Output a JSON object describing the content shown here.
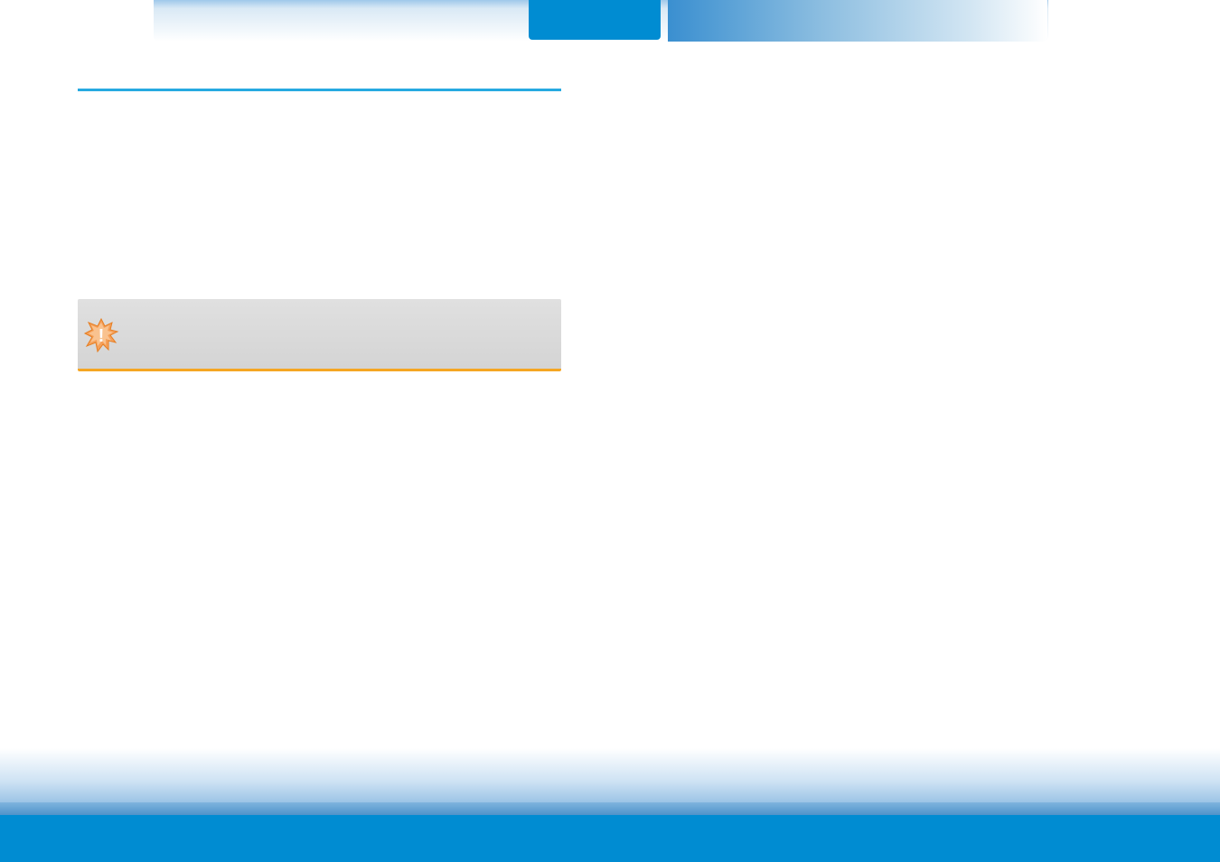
{
  "topbar": {
    "active_tab_label": "",
    "inactive_tab_label": ""
  },
  "content": {
    "heading": "",
    "callout_text": ""
  },
  "footer": {
    "text": ""
  }
}
